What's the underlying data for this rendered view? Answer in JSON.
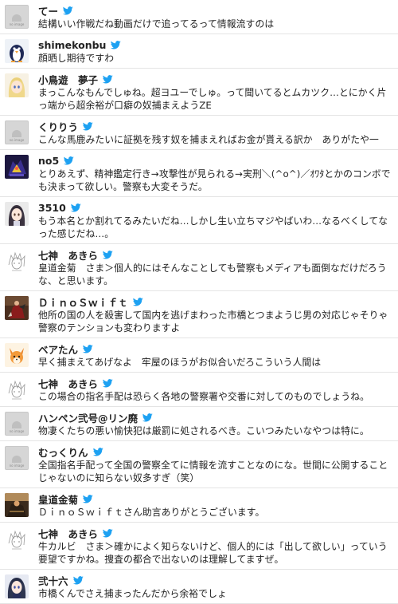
{
  "icon_bird": "twitter-bird-icon",
  "accent": "#1da1f2",
  "tweets": [
    {
      "name": "てー",
      "avatar": "no-image",
      "text": "結構いい作戦だね動画だけで追ってるって情報流すのは"
    },
    {
      "name": "shimekonbu",
      "avatar": "penguin",
      "text": "顔晒し期待ですわ"
    },
    {
      "name": "小鳥遊　夢子",
      "avatar": "anime-blonde",
      "text": "まっこんなもんでしゅね。超ヨユーでしゅ。って聞いてるとムカツク…とにかく片っ端から超余裕が口癖の奴捕まえようZE"
    },
    {
      "name": "くりりう",
      "avatar": "no-image",
      "text": "こんな馬鹿みたいに証拠を残す奴を捕まえればお金が貰える訳か　ありがたや一"
    },
    {
      "name": "no5",
      "avatar": "mecha",
      "text": "とりあえず、精神鑑定行き→攻撃性が見られる→実刑＼(^o^)／ｵﾜﾀとかのコンボでも決まって欲しい。警察も大変そうだ。"
    },
    {
      "name": "3510",
      "avatar": "anime-dark-hair",
      "text": "もう本名とか割れてるみたいだね…しかし生い立ちマジやばいわ…なるべくしてなった感じだね…。"
    },
    {
      "name": "七神　あきら",
      "avatar": "sketch",
      "text": "皇道金菊　さま＞個人的にはそんなことしても警察もメディアも面倒なだけだろうな、と思います。"
    },
    {
      "name": "ＤｉｎｏＳｗｉｆｔ",
      "avatar": "painting",
      "text": "他所の国の人を殺害して国内を逃げまわった市橋とつまようじ男の対応じゃそりゃ警察のテンションも変わりますよ"
    },
    {
      "name": "ベアたん",
      "avatar": "fox",
      "text": "早く捕まえてあげなよ　牢屋のほうがお似合いだろこういう人間は"
    },
    {
      "name": "七神　あきら",
      "avatar": "sketch",
      "text": "この場合の指名手配は恐らく各地の警察署や交番に対してのものでしょうね。"
    },
    {
      "name": "ハンペン弐号@リン廃",
      "avatar": "no-image",
      "text": "物凄くたちの悪い愉快犯は厳罰に処されるべき。こいつみたいなやつは特に。"
    },
    {
      "name": "むっくりん",
      "avatar": "no-image",
      "text": "全国指名手配って全国の警察全てに情報を流すことなのにな。世間に公開することじゃないのに知らない奴多すぎ（笑）"
    },
    {
      "name": "皇道金菊",
      "avatar": "dark-photo",
      "text": "ＤｉｎｏＳｗｉｆｔさん助言ありがとうございます。"
    },
    {
      "name": "七神　あきら",
      "avatar": "sketch",
      "text": "牛カルビ　さま＞確かによく知らないけど、個人的には「出して欲しい」っていう要望ですかね。捜査の都合で出ないのは理解してますぜ。"
    },
    {
      "name": "弐十六",
      "avatar": "anime-girl",
      "text": "市橋くんでさえ捕まったんだから余裕でしょ"
    }
  ]
}
